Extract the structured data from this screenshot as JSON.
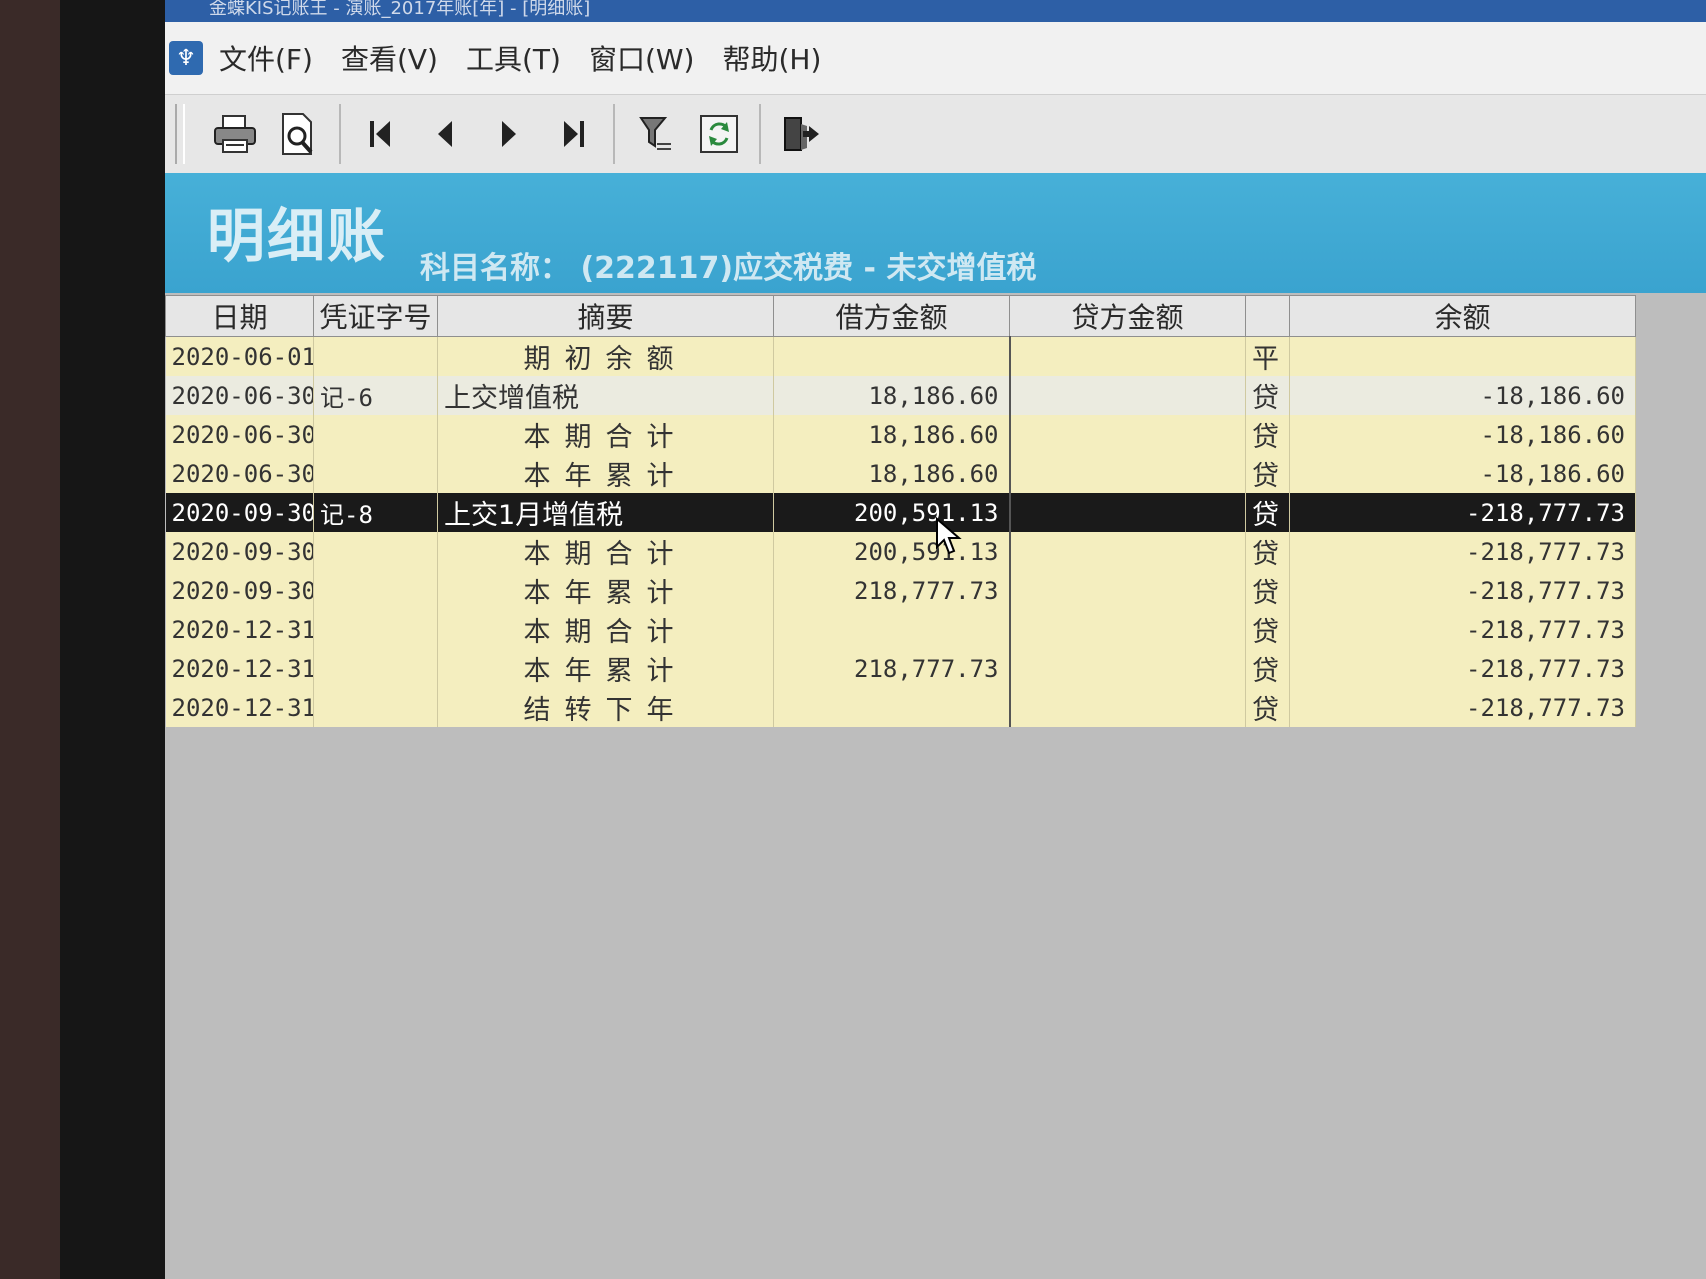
{
  "window": {
    "title": "金蝶KIS记账王 - 演账_2017年账[年] - [明细账]"
  },
  "menu": [
    "文件(F)",
    "查看(V)",
    "工具(T)",
    "窗口(W)",
    "帮助(H)"
  ],
  "toolbar": {
    "buttons": [
      "printer-icon",
      "print-preview-icon",
      "first-record-icon",
      "previous-record-icon",
      "next-record-icon",
      "last-record-icon",
      "filter-icon",
      "refresh-icon",
      "exit-icon"
    ]
  },
  "banner": {
    "title": "明细账",
    "subject": "科目名称： (222117)应交税费 - 未交增值税"
  },
  "table": {
    "columns": [
      "日期",
      "凭证字号",
      "摘要",
      "借方金额",
      "贷方金额",
      "",
      "余额"
    ],
    "rows": [
      {
        "date": "2020-06-01",
        "voucher": "",
        "summary": "期初余额",
        "debit": "",
        "credit": "",
        "direction": "平",
        "balance": ""
      },
      {
        "date": "2020-06-30",
        "voucher": "记-6",
        "summary": "上交增值税",
        "debit": "18,186.60",
        "credit": "",
        "direction": "贷",
        "balance": "-18,186.60"
      },
      {
        "date": "2020-06-30",
        "voucher": "",
        "summary": "本期合计",
        "debit": "18,186.60",
        "credit": "",
        "direction": "贷",
        "balance": "-18,186.60"
      },
      {
        "date": "2020-06-30",
        "voucher": "",
        "summary": "本年累计",
        "debit": "18,186.60",
        "credit": "",
        "direction": "贷",
        "balance": "-18,186.60"
      },
      {
        "date": "2020-09-30",
        "voucher": "记-8",
        "summary": "上交1月增值税",
        "debit": "200,591.13",
        "credit": "",
        "direction": "贷",
        "balance": "-218,777.73"
      },
      {
        "date": "2020-09-30",
        "voucher": "",
        "summary": "本期合计",
        "debit": "200,591.13",
        "credit": "",
        "direction": "贷",
        "balance": "-218,777.73"
      },
      {
        "date": "2020-09-30",
        "voucher": "",
        "summary": "本年累计",
        "debit": "218,777.73",
        "credit": "",
        "direction": "贷",
        "balance": "-218,777.73"
      },
      {
        "date": "2020-12-31",
        "voucher": "",
        "summary": "本期合计",
        "debit": "",
        "credit": "",
        "direction": "贷",
        "balance": "-218,777.73"
      },
      {
        "date": "2020-12-31",
        "voucher": "",
        "summary": "本年累计",
        "debit": "218,777.73",
        "credit": "",
        "direction": "贷",
        "balance": "-218,777.73"
      },
      {
        "date": "2020-12-31",
        "voucher": "",
        "summary": "结转下年",
        "debit": "",
        "credit": "",
        "direction": "贷",
        "balance": "-218,777.73"
      }
    ]
  },
  "colors": {
    "banner": "#3aa3cf",
    "row_bg": "#f4eebf",
    "selected_bg": "#1a1a1a"
  }
}
